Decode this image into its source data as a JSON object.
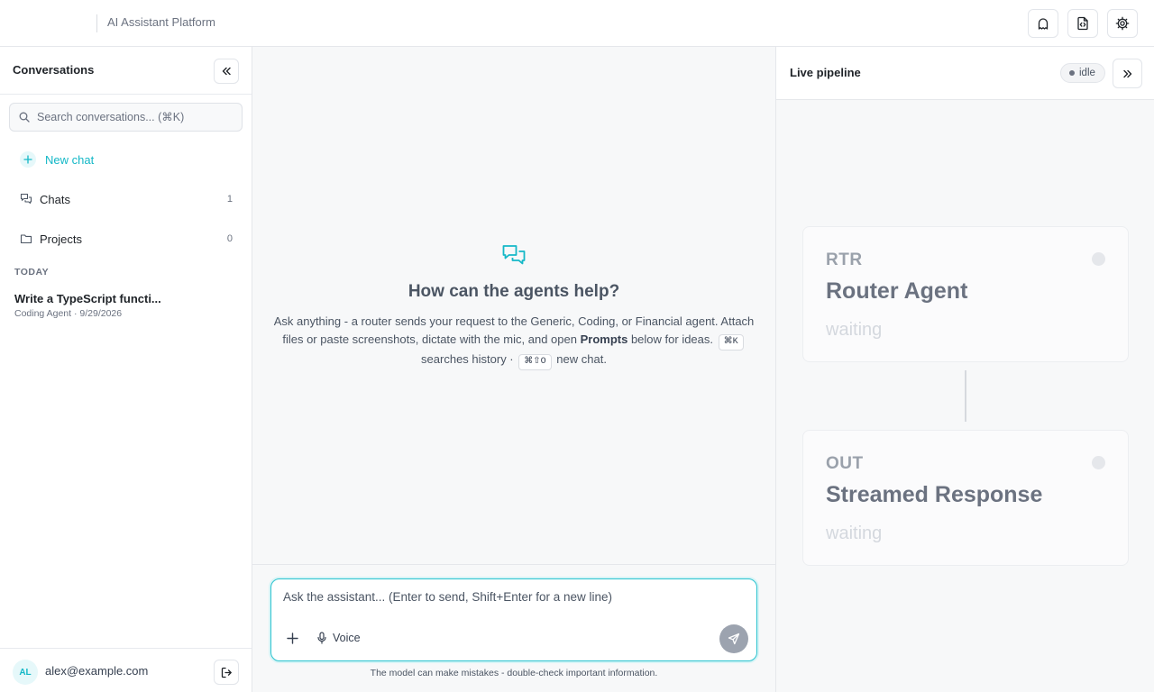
{
  "header": {
    "app_title": "AI Assistant Platform",
    "actions": [
      {
        "name": "notifications",
        "icon": "ghost-icon"
      },
      {
        "name": "export",
        "icon": "file-code-icon"
      },
      {
        "name": "settings",
        "icon": "gear-icon"
      }
    ]
  },
  "sidebar": {
    "title": "Conversations",
    "search_placeholder": "Search conversations... (⌘K)",
    "new_chat_label": "New chat",
    "nav": [
      {
        "label": "Chats",
        "count": "1",
        "icon": "chats-icon"
      },
      {
        "label": "Projects",
        "count": "0",
        "icon": "folder-icon"
      }
    ],
    "section_label": "TODAY",
    "conversations": [
      {
        "title": "Write a TypeScript functi...",
        "meta": "Coding Agent · 9/29/2026"
      }
    ],
    "user": {
      "initials": "AL",
      "email": "alex@example.com"
    }
  },
  "main": {
    "empty_title": "How can the agents help?",
    "desc_part1": "Ask anything - a router sends your request to the Generic, Coding, or Financial agent. Attach files or paste screenshots, dictate with the mic, and open",
    "desc_bold": "Prompts",
    "desc_part2": "below for ideas.",
    "kbd_search": "⌘K",
    "desc_part3": "searches history ·",
    "kbd_new": "⌘⇧O",
    "desc_part4": "new chat.",
    "composer_placeholder": "Ask the assistant... (Enter to send, Shift+Enter for a new line)",
    "voice_label": "Voice",
    "disclaimer": "The model can make mistakes - double-check important information."
  },
  "pipeline": {
    "title": "Live pipeline",
    "status": "idle",
    "stages": [
      {
        "code": "RTR",
        "name": "Router Agent",
        "status": "waiting"
      },
      {
        "code": "OUT",
        "name": "Streamed Response",
        "status": "waiting"
      }
    ]
  },
  "colors": {
    "accent": "#14b8c7",
    "accent_soft": "#e6f8fa",
    "muted": "#6b7280"
  }
}
